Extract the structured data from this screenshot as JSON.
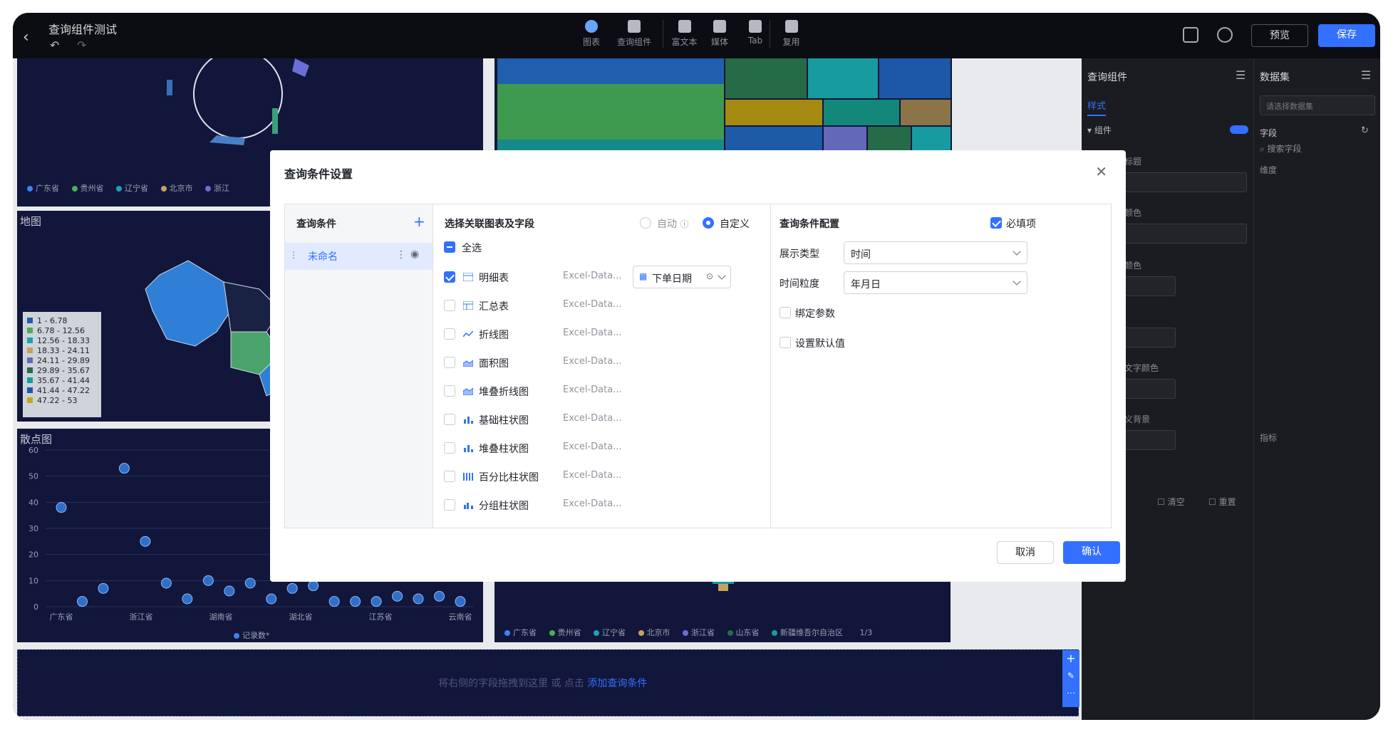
{
  "app": {
    "title": "查询组件测试",
    "toolbar": [
      {
        "label": "图表",
        "icon": "chart-icon"
      },
      {
        "label": "查询组件",
        "icon": "filter-icon"
      },
      {
        "label": "富文本",
        "icon": "richtext-icon"
      },
      {
        "label": "媒体",
        "icon": "media-icon"
      },
      {
        "label": "Tab",
        "icon": "tab-icon"
      },
      {
        "label": "复用",
        "icon": "reuse-icon"
      }
    ],
    "preview_label": "预览",
    "save_label": "保存"
  },
  "canvas": {
    "province_legend": [
      "广东省",
      "贵州省",
      "辽宁省",
      "北京市",
      "浙江"
    ],
    "map_title": "地图",
    "map_legend": [
      "1 - 6.78",
      "6.78 - 12.56",
      "12.56 - 18.33",
      "18.33 - 24.11",
      "24.11 - 29.89",
      "29.89 - 35.67",
      "35.67 - 41.44",
      "41.44 - 47.22",
      "47.22 - 53"
    ],
    "scatter_title": "散点图",
    "scatter_legend": "记录数*",
    "bottom_legend": [
      "广东省",
      "贵州省",
      "辽宁省",
      "北京市",
      "浙江省",
      "山东省",
      "新疆维吾尔自治区"
    ],
    "bottom_page": "1/3",
    "drop_hint": "将右侧的字段拖拽到这里 或 点击",
    "drop_link": "添加查询条件"
  },
  "chart_data": {
    "type": "scatter",
    "title": "散点图",
    "ylim": [
      0,
      60
    ],
    "yticks": [
      "60",
      "50",
      "40",
      "30",
      "20",
      "10",
      "0"
    ],
    "xticks": [
      "广东省",
      "浙江省",
      "湖南省",
      "湖北省",
      "江苏省",
      "云南省"
    ],
    "series": [
      {
        "name": "记录数*",
        "values": [
          38,
          2,
          7,
          53,
          25,
          9,
          3,
          10,
          6,
          9,
          3,
          7,
          8,
          2,
          2,
          2,
          4,
          3,
          4,
          2
        ]
      }
    ]
  },
  "right_panel": {
    "query_title": "查询组件",
    "style_tab": "样式",
    "component_section": "组件",
    "dataset_title": "数据集",
    "dataset_placeholder": "请选择数据集",
    "field_label": "字段",
    "search_placeholder": "搜索字段",
    "dimension_label": "维度",
    "metric_label": "指标",
    "partial_labels": [
      "标题",
      "颜色",
      "颜色",
      "文字颜色",
      "义背景"
    ],
    "clear_label": "清空",
    "reset_label": "重置"
  },
  "modal": {
    "title": "查询条件设置",
    "conditions_header": "查询条件",
    "condition_item": "未命名",
    "fields_header": "选择关联图表及字段",
    "auto_label": "自动",
    "custom_label": "自定义",
    "select_all": "全选",
    "charts": [
      {
        "name": "明细表",
        "source": "Excel-Data...",
        "checked": true,
        "field": "下单日期"
      },
      {
        "name": "汇总表",
        "source": "Excel-Data...",
        "checked": false
      },
      {
        "name": "折线图",
        "source": "Excel-Data...",
        "checked": false
      },
      {
        "name": "面积图",
        "source": "Excel-Data...",
        "checked": false
      },
      {
        "name": "堆叠折线图",
        "source": "Excel-Data...",
        "checked": false
      },
      {
        "name": "基础柱状图",
        "source": "Excel-Data...",
        "checked": false
      },
      {
        "name": "堆叠柱状图",
        "source": "Excel-Data...",
        "checked": false
      },
      {
        "name": "百分比柱状图",
        "source": "Excel-Data...",
        "checked": false
      },
      {
        "name": "分组柱状图",
        "source": "Excel-Data...",
        "checked": false
      }
    ],
    "config_header": "查询条件配置",
    "required_label": "必填项",
    "display_type_label": "展示类型",
    "display_type_value": "时间",
    "granularity_label": "时间粒度",
    "granularity_value": "年月日",
    "bind_param_label": "绑定参数",
    "default_value_label": "设置默认值",
    "cancel_label": "取消",
    "confirm_label": "确认"
  },
  "colors": {
    "accent": "#3370ff",
    "panel": "#11163a"
  }
}
